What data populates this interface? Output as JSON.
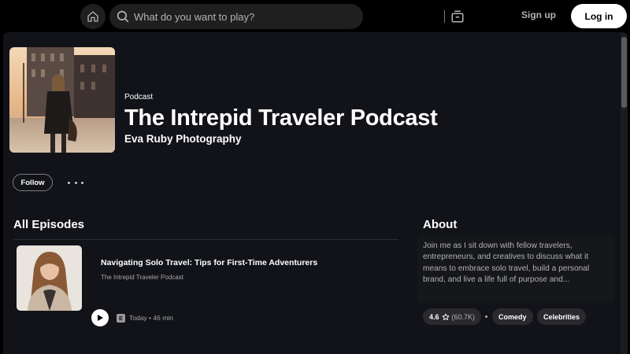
{
  "topbar": {
    "home_icon": "home-icon",
    "search_placeholder": "What do you want to play?",
    "search_icon": "search-icon",
    "browse_icon": "browse-icon",
    "signup_label": "Sign up",
    "login_label": "Log in"
  },
  "podcast": {
    "kind": "Podcast",
    "title": "The Intrepid Traveler Podcast",
    "author": "Eva Ruby Photography",
    "follow_label": "Follow"
  },
  "episodes": {
    "section_title": "All Episodes",
    "items": [
      {
        "title": "Navigating Solo Travel: Tips for First-Time Adventurers",
        "show": "The Intrepid Traveler Podcast",
        "explicit": "E",
        "meta": "Today • 46 min"
      }
    ]
  },
  "about": {
    "section_title": "About",
    "description": "Join me as I sit down with fellow travelers, entrepreneurs, and creatives to discuss what it means to embrace solo travel, build a personal brand, and live a life full of purpose and...",
    "rating": "4.6",
    "rating_count": "(60.7K)",
    "tags": [
      "Comedy",
      "Celebrities"
    ]
  },
  "colors": {
    "background": "#000000",
    "panel": "#121318",
    "accent_button": "#ffffff",
    "muted_text": "#b3b3b3"
  }
}
